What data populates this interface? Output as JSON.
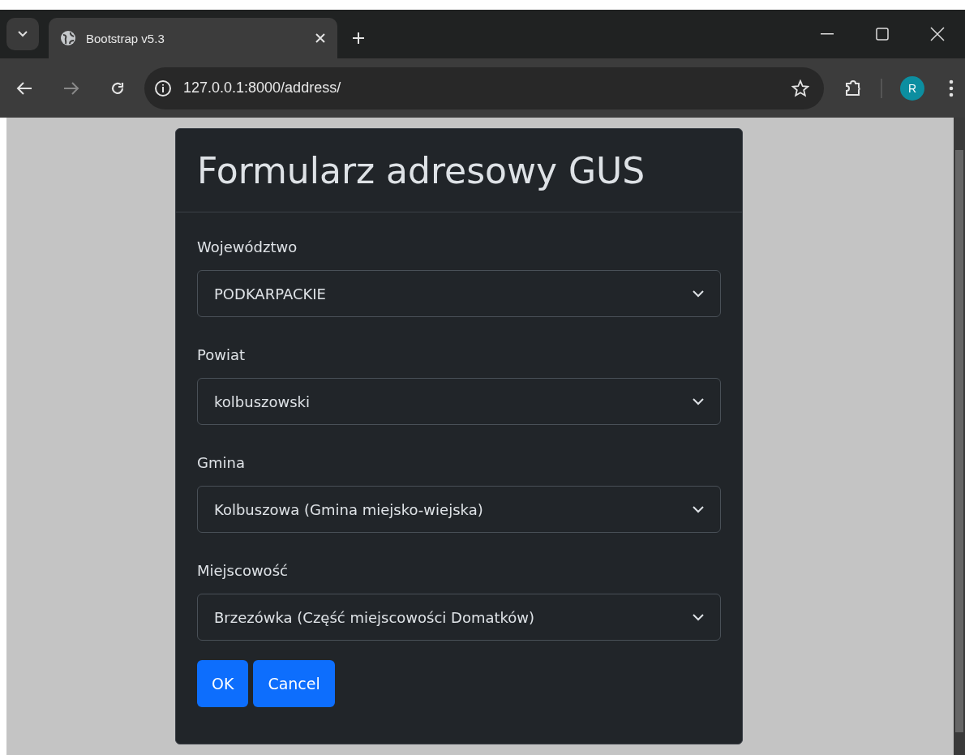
{
  "browser": {
    "tab": {
      "title": "Bootstrap v5.3",
      "selected": true
    },
    "address": "127.0.0.1:8000/address/",
    "profile": "R"
  },
  "form": {
    "title": "Formularz adresowy GUS",
    "fields": [
      {
        "label": "Województwo",
        "value": "PODKARPACKIE"
      },
      {
        "label": "Powiat",
        "value": "kolbuszowski"
      },
      {
        "label": "Gmina",
        "value": "Kolbuszowa (Gmina miejsko-wiejska)"
      },
      {
        "label": "Miejscowość",
        "value": "Brzezówka (Część miejscowości Domatków)"
      }
    ],
    "buttons": [
      "OK",
      "Cancel"
    ]
  }
}
